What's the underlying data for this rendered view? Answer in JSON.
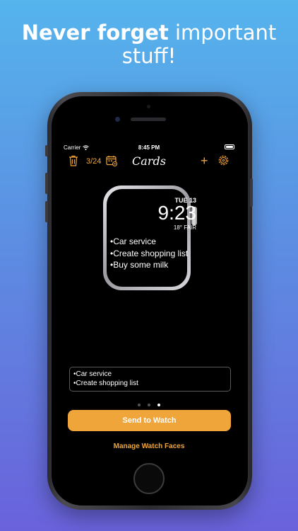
{
  "headline": {
    "bold": "Never forget",
    "rest": " important stuff!"
  },
  "status": {
    "carrier": "Carrier",
    "time": "8:45 PM"
  },
  "nav": {
    "count": "3/24",
    "title": "Cards",
    "plus": "+"
  },
  "watch": {
    "date": "TUE 13",
    "time": "9:23",
    "weather": "18° FAIR",
    "items": [
      "•Car service",
      "•Create shopping list",
      "•Buy some milk"
    ]
  },
  "notes": {
    "lines": [
      "•Car service",
      "•Create shopping list"
    ]
  },
  "pager": {
    "count": 3,
    "active_index": 2
  },
  "actions": {
    "send": "Send to Watch",
    "manage": "Manage Watch Faces"
  },
  "colors": {
    "accent": "#f0a53a",
    "screen_bg": "#000000"
  },
  "icons": [
    "trash-icon",
    "calendar-icon",
    "plus-icon",
    "gear-icon",
    "wifi-icon",
    "battery-icon"
  ]
}
